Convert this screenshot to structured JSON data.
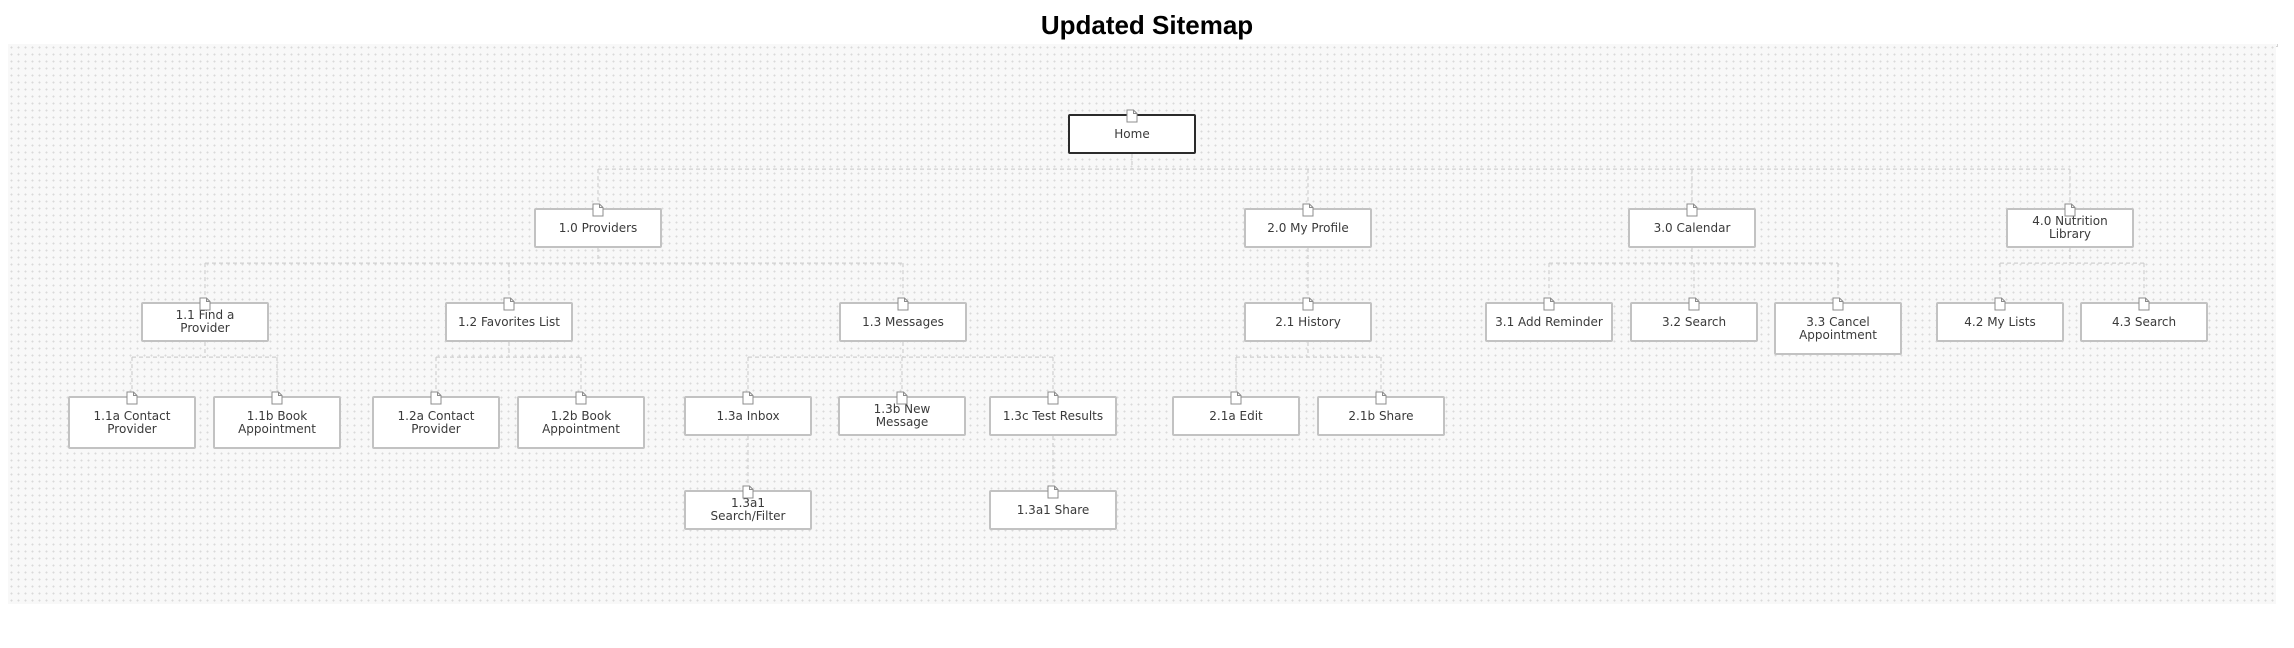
{
  "title": "Updated Sitemap",
  "nodes": {
    "home": "Home",
    "n1_0": "1.0 Providers",
    "n2_0": "2.0 My Profile",
    "n3_0": "3.0 Calendar",
    "n4_0": "4.0 Nutrition Library",
    "n1_1": "1.1 Find a Provider",
    "n1_2": "1.2 Favorites List",
    "n1_3": "1.3 Messages",
    "n2_1": "2.1 History",
    "n3_1": "3.1 Add Reminder",
    "n3_2": "3.2 Search",
    "n3_3": "3.3 Cancel\nAppointment",
    "n4_2": "4.2 My Lists",
    "n4_3": "4.3 Search",
    "n1_1a": "1.1a Contact\nProvider",
    "n1_1b": "1.1b Book\nAppointment",
    "n1_2a": "1.2a Contact\nProvider",
    "n1_2b": "1.2b Book\nAppointment",
    "n1_3a": "1.3a Inbox",
    "n1_3b": "1.3b New Message",
    "n1_3c": "1.3c Test Results",
    "n2_1a": "2.1a Edit",
    "n2_1b": "2.1b Share",
    "n1_3a1": "1.3a1 Search/Filter",
    "n1_3c1": "1.3a1 Share"
  },
  "icons": {
    "page": "page-icon"
  },
  "colors": {
    "connector": "#cfcfcf",
    "node_border": "#c2c2c2",
    "home_border": "#2b2b2b",
    "node_text": "#3a3a3a"
  }
}
